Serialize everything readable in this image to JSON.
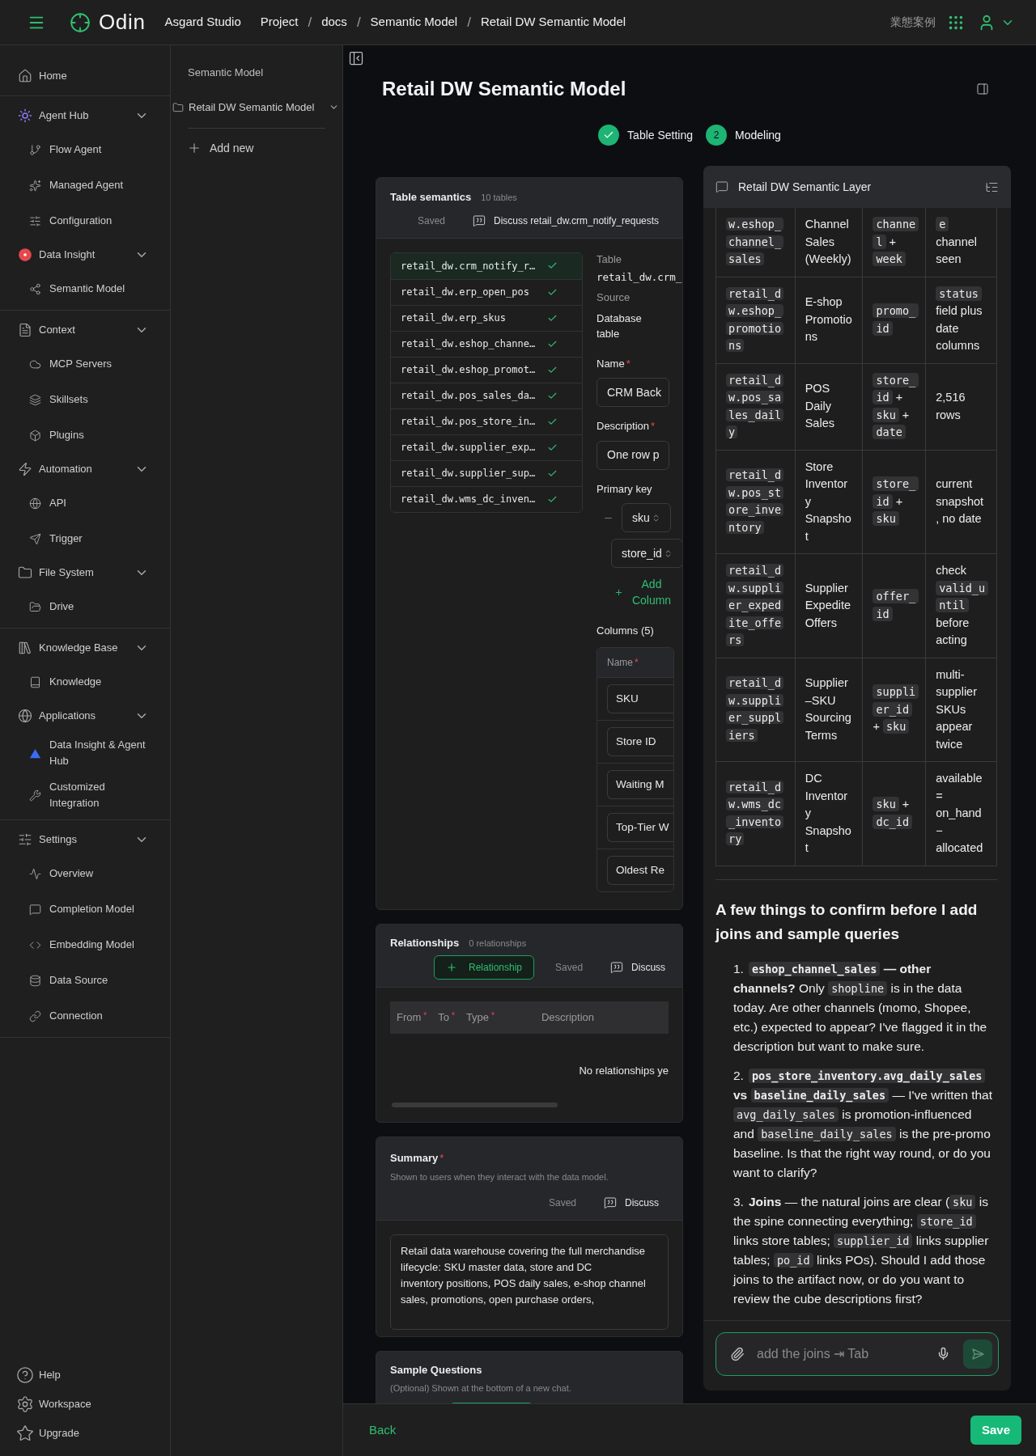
{
  "topbar": {
    "app_name": "Odin",
    "breadcrumbs": [
      {
        "kind": "crumb",
        "text": "Asgard Studio"
      },
      {
        "kind": "crumb",
        "text": "Project"
      },
      {
        "kind": "separator",
        "text": "/"
      },
      {
        "kind": "crumb",
        "text": "docs"
      },
      {
        "kind": "separator",
        "text": "/"
      },
      {
        "kind": "crumb",
        "text": "Semantic Model"
      },
      {
        "kind": "separator",
        "text": "/"
      },
      {
        "kind": "crumb",
        "text": "Retail DW Semantic Model"
      }
    ],
    "workspace_label": "業態案例"
  },
  "sidebar": {
    "sections": [
      {
        "items": [
          {
            "label": "Home"
          }
        ]
      },
      {
        "items": [
          {
            "label": "Agent Hub",
            "expanded": true,
            "children": [
              {
                "label": "Flow Agent"
              },
              {
                "label": "Managed Agent"
              },
              {
                "label": "Configuration"
              }
            ]
          },
          {
            "label": "Data Insight",
            "expanded": true,
            "children": [
              {
                "label": "Semantic Model"
              }
            ]
          }
        ]
      },
      {
        "items": [
          {
            "label": "Context",
            "expanded": true,
            "children": [
              {
                "label": "MCP Servers"
              },
              {
                "label": "Skillsets"
              },
              {
                "label": "Plugins"
              }
            ]
          },
          {
            "label": "Automation",
            "expanded": true,
            "children": [
              {
                "label": "API"
              },
              {
                "label": "Trigger"
              }
            ]
          },
          {
            "label": "File System",
            "expanded": true,
            "children": [
              {
                "label": "Drive"
              }
            ]
          }
        ]
      },
      {
        "items": [
          {
            "label": "Knowledge Base",
            "expanded": true,
            "children": [
              {
                "label": "Knowledge"
              }
            ]
          },
          {
            "label": "Applications",
            "expanded": true,
            "children": [
              {
                "label": "Data Insight & Agent Hub"
              },
              {
                "label": "Customized Integration"
              }
            ]
          }
        ]
      },
      {
        "items": [
          {
            "label": "Settings",
            "expanded": true,
            "children": [
              {
                "label": "Overview"
              },
              {
                "label": "Completion Model"
              },
              {
                "label": "Embedding Model"
              },
              {
                "label": "Data Source"
              },
              {
                "label": "Connection"
              }
            ]
          }
        ]
      }
    ],
    "footer": [
      {
        "label": "Help"
      },
      {
        "label": "Workspace"
      },
      {
        "label": "Upgrade"
      }
    ]
  },
  "tree_panel": {
    "title": "Semantic Model",
    "items": [
      {
        "label": "Retail DW Semantic Model",
        "expanded": true
      }
    ],
    "add_label": "Add new"
  },
  "page": {
    "title": "Retail DW Semantic Model",
    "steps": [
      {
        "label": "Table Setting",
        "completed": true
      },
      {
        "label": "Modeling",
        "number": "2",
        "completed": false
      }
    ]
  },
  "table_semantics": {
    "title": "Table semantics",
    "count": "10 tables",
    "saved": "Saved",
    "discuss": "Discuss retail_dw.crm_notify_requests",
    "tables": [
      {
        "name": "retail_dw.crm_notify_r…",
        "checked": true,
        "selected": true
      },
      {
        "name": "retail_dw.erp_open_pos",
        "checked": true,
        "selected": false
      },
      {
        "name": "retail_dw.erp_skus",
        "checked": true,
        "selected": false
      },
      {
        "name": "retail_dw.eshop_channe…",
        "checked": true,
        "selected": false
      },
      {
        "name": "retail_dw.eshop_promot…",
        "checked": true,
        "selected": false
      },
      {
        "name": "retail_dw.pos_sales_da…",
        "checked": true,
        "selected": false
      },
      {
        "name": "retail_dw.pos_store_in…",
        "checked": true,
        "selected": false
      },
      {
        "name": "retail_dw.supplier_exp…",
        "checked": true,
        "selected": false
      },
      {
        "name": "retail_dw.supplier_sup…",
        "checked": true,
        "selected": false
      },
      {
        "name": "retail_dw.wms_dc_inven…",
        "checked": true,
        "selected": false
      }
    ],
    "detail": {
      "table_label": "Table",
      "table_value": "retail_dw.crm_",
      "source_label": "Source",
      "source_value": "Database table",
      "name_label": "Name",
      "name_asterisk": "*",
      "name_value": "CRM Back",
      "description_label": "Description",
      "description_asterisk": "*",
      "description_value": "One row p",
      "primary_key_label": "Primary key",
      "primary_keys": [
        "sku",
        "store_id"
      ],
      "add_column": "Add Column",
      "columns_label": "Columns (5)",
      "columns_header": "Name",
      "columns_header_asterisk": "*",
      "columns": [
        "SKU",
        "Store ID",
        "Waiting M",
        "Top-Tier W",
        "Oldest Re"
      ]
    }
  },
  "relationships": {
    "title": "Relationships",
    "count": "0 relationships",
    "add_button": "Relationship",
    "saved": "Saved",
    "discuss": "Discuss",
    "columns": [
      {
        "label": "From",
        "asterisk": "*"
      },
      {
        "label": "To",
        "asterisk": "*"
      },
      {
        "label": "Type",
        "asterisk": "*"
      },
      {
        "label": "Description"
      }
    ],
    "empty": "No relationships ye"
  },
  "summary": {
    "title": "Summary",
    "asterisk": "*",
    "subtitle": "Shown to users when they interact with the data model.",
    "saved": "Saved",
    "discuss": "Discuss",
    "value": "Retail data warehouse covering the full merchandise lifecycle: SKU master data, store and DC\ninventory positions, POS daily sales, e-shop channel sales, promotions, open purchase orders,"
  },
  "sample_questions": {
    "title": "Sample Questions",
    "subtitle": "(Optional) Shown at the bottom of a new chat."
  },
  "chat": {
    "title": "Retail DW Semantic Layer",
    "rows": [
      {
        "table": "w.eshop_channel_sales",
        "name": "Channel Sales (Weekly)",
        "key": [
          {
            "kind": "code",
            "text": "channel"
          },
          {
            "kind": "text",
            "text": " + "
          },
          {
            "kind": "code",
            "text": "week"
          }
        ],
        "notes": [
          {
            "kind": "code",
            "text": "e"
          },
          {
            "kind": "text",
            "text": " channel seen"
          }
        ]
      },
      {
        "table": "retail_dw.eshop_promotions",
        "name": "E-shop Promotions",
        "key": [
          {
            "kind": "code",
            "text": "promo_id"
          }
        ],
        "notes": [
          {
            "kind": "code",
            "text": "status"
          },
          {
            "kind": "text",
            "text": " field plus date columns"
          }
        ]
      },
      {
        "table": "retail_dw.pos_sales_daily",
        "name": "POS Daily Sales",
        "key": [
          {
            "kind": "code",
            "text": "store_id"
          },
          {
            "kind": "text",
            "text": " + "
          },
          {
            "kind": "code",
            "text": "sku"
          },
          {
            "kind": "text",
            "text": " + "
          },
          {
            "kind": "code",
            "text": "date"
          }
        ],
        "notes": [
          {
            "kind": "text",
            "text": "2,516 rows"
          }
        ]
      },
      {
        "table": "retail_dw.pos_store_inventory",
        "name": "Store Inventory Snapshot",
        "key": [
          {
            "kind": "code",
            "text": "store_id"
          },
          {
            "kind": "text",
            "text": " + "
          },
          {
            "kind": "code",
            "text": "sku"
          }
        ],
        "notes": [
          {
            "kind": "text",
            "text": "current snapshot, no date"
          }
        ]
      },
      {
        "table": "retail_dw.supplier_expedite_offers",
        "name": "Supplier Expedite Offers",
        "key": [
          {
            "kind": "code",
            "text": "offer_id"
          }
        ],
        "notes": [
          {
            "kind": "text",
            "text": "check "
          },
          {
            "kind": "code",
            "text": "valid_until"
          },
          {
            "kind": "text",
            "text": " before acting"
          }
        ]
      },
      {
        "table": "retail_dw.supplier_suppliers",
        "name": "Supplier–SKU Sourcing Terms",
        "key": [
          {
            "kind": "code",
            "text": "supplier_id"
          },
          {
            "kind": "text",
            "text": " + "
          },
          {
            "kind": "code",
            "text": "sku"
          }
        ],
        "notes": [
          {
            "kind": "text",
            "text": "multi-supplier SKUs appear twice"
          }
        ]
      },
      {
        "table": "retail_dw.wms_dc_inventory",
        "name": "DC Inventory Snapshot",
        "key": [
          {
            "kind": "code",
            "text": "sku"
          },
          {
            "kind": "text",
            "text": " + "
          },
          {
            "kind": "code",
            "text": "dc_id"
          }
        ],
        "notes": [
          {
            "kind": "text",
            "text": "available = on_hand − allocated"
          }
        ]
      }
    ],
    "heading": "A few things to confirm before I add joins and sample queries",
    "items": [
      {
        "number": "1.",
        "segments": [
          {
            "kind": "bold_code",
            "text": "eshop_channel_sales"
          },
          {
            "kind": "bold",
            "text": " — other channels?"
          },
          {
            "kind": "text",
            "text": " Only "
          },
          {
            "kind": "code",
            "text": "shopline"
          },
          {
            "kind": "text",
            "text": " is in the data today. Are other channels (momo, Shopee, etc.) expected to appear? I've flagged it in the description but want to make sure."
          }
        ]
      },
      {
        "number": "2.",
        "segments": [
          {
            "kind": "bold_code",
            "text": "pos_store_inventory.avg_daily_sales"
          },
          {
            "kind": "bold",
            "text": " vs "
          },
          {
            "kind": "bold_code",
            "text": "baseline_daily_sales"
          },
          {
            "kind": "text",
            "text": " — I've written that "
          },
          {
            "kind": "code",
            "text": "avg_daily_sales"
          },
          {
            "kind": "text",
            "text": " is promotion-influenced and "
          },
          {
            "kind": "code",
            "text": "baseline_daily_sales"
          },
          {
            "kind": "text",
            "text": " is the pre-promo baseline. Is that the right way round, or do you want to clarify?"
          }
        ]
      },
      {
        "number": "3.",
        "segments": [
          {
            "kind": "bold",
            "text": "Joins"
          },
          {
            "kind": "text",
            "text": " — the natural joins are clear ("
          },
          {
            "kind": "code",
            "text": "sku"
          },
          {
            "kind": "text",
            "text": " is the spine connecting everything; "
          },
          {
            "kind": "code",
            "text": "store_id"
          },
          {
            "kind": "text",
            "text": " links store tables; "
          },
          {
            "kind": "code",
            "text": "supplier_id"
          },
          {
            "kind": "text",
            "text": " links supplier tables; "
          },
          {
            "kind": "code",
            "text": "po_id"
          },
          {
            "kind": "text",
            "text": " links POs). Should I add those joins to the artifact now, or do you want to review the cube descriptions first?"
          }
        ]
      }
    ],
    "input_placeholder": "add the joins ⇥ Tab"
  },
  "footer": {
    "back": "Back",
    "save": "Save"
  }
}
